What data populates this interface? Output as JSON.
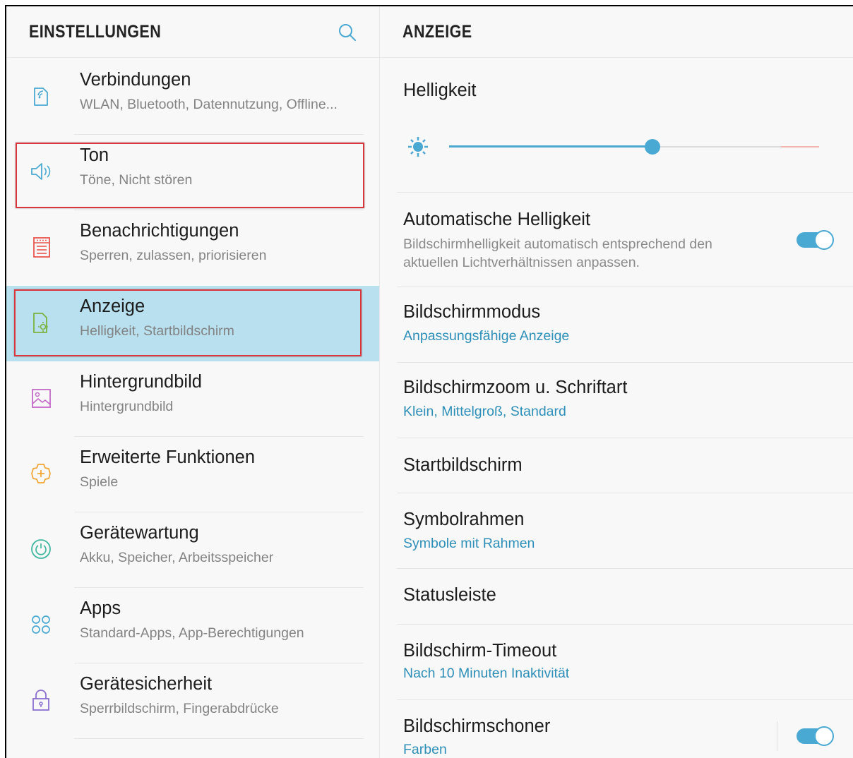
{
  "left_panel": {
    "header_title": "EINSTELLUNGEN",
    "items": [
      {
        "title": "Verbindungen",
        "subtitle": "WLAN, Bluetooth, Datennutzung, Offline..."
      },
      {
        "title": "Ton",
        "subtitle": "Töne, Nicht stören"
      },
      {
        "title": "Benachrichtigungen",
        "subtitle": "Sperren, zulassen, priorisieren"
      },
      {
        "title": "Anzeige",
        "subtitle": "Helligkeit, Startbildschirm"
      },
      {
        "title": "Hintergrundbild",
        "subtitle": "Hintergrundbild"
      },
      {
        "title": "Erweiterte Funktionen",
        "subtitle": "Spiele"
      },
      {
        "title": "Gerätewartung",
        "subtitle": "Akku, Speicher, Arbeitsspeicher"
      },
      {
        "title": "Apps",
        "subtitle": "Standard-Apps, App-Berechtigungen"
      },
      {
        "title": "Gerätesicherheit",
        "subtitle": "Sperrbildschirm, Fingerabdrücke"
      }
    ],
    "selected_item": "Anzeige"
  },
  "right_panel": {
    "header_title": "ANZEIGE",
    "brightness": {
      "title": "Helligkeit",
      "level_fraction": 0.55
    },
    "auto_brightness": {
      "title": "Automatische Helligkeit",
      "description": "Bildschirmhelligkeit automatisch entsprechend den aktuellen Lichtverhältnissen anpassen.",
      "enabled": true
    },
    "screen_mode": {
      "title": "Bildschirmmodus",
      "value": "Anpassungsfähige Anzeige"
    },
    "zoom_font": {
      "title": "Bildschirmzoom u. Schriftart",
      "value": "Klein, Mittelgroß, Standard"
    },
    "home_screen": {
      "title": "Startbildschirm"
    },
    "icon_frames": {
      "title": "Symbolrahmen",
      "value": "Symbole mit Rahmen"
    },
    "status_bar": {
      "title": "Statusleiste"
    },
    "screen_timeout": {
      "title": "Bildschirm-Timeout",
      "value": "Nach 10 Minuten Inaktivität"
    },
    "screensaver": {
      "title": "Bildschirmschoner",
      "value": "Farben",
      "enabled": true
    }
  },
  "colors": {
    "accent": "#4aa9d3",
    "selection_bg": "#b8e0ee",
    "highlight_border": "#d9363e"
  },
  "icons": [
    "search-icon",
    "connections-icon",
    "sound-icon",
    "notifications-icon",
    "display-icon",
    "wallpaper-icon",
    "advanced-features-icon",
    "device-maintenance-icon",
    "apps-icon",
    "security-icon",
    "brightness-icon"
  ]
}
